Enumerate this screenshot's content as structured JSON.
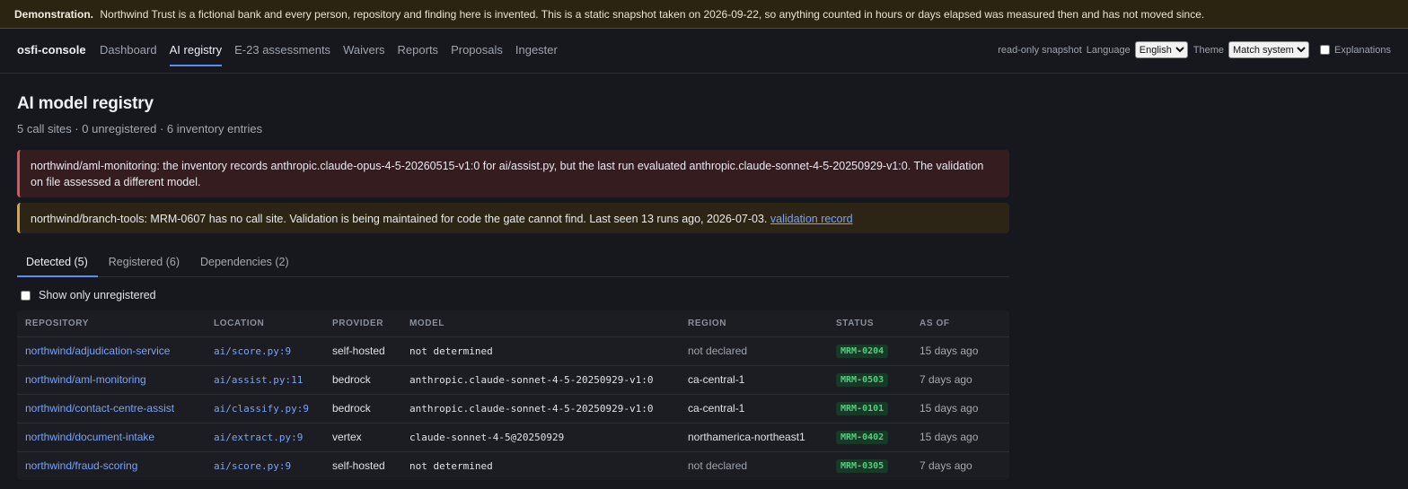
{
  "banner": {
    "label": "Demonstration.",
    "text": "Northwind Trust is a fictional bank and every person, repository and finding here is invented. This is a static snapshot taken on 2026-09-22, so anything counted in hours or days elapsed was measured then and has not moved since."
  },
  "nav": {
    "brand": "osfi-console",
    "links": [
      "Dashboard",
      "AI registry",
      "E-23 assessments",
      "Waivers",
      "Reports",
      "Proposals",
      "Ingester"
    ],
    "active_index": 1,
    "snapshot_label": "read-only snapshot",
    "language_label": "Language",
    "language_value": "English",
    "theme_label": "Theme",
    "theme_value": "Match system",
    "explanations_label": "Explanations"
  },
  "page": {
    "title": "AI model registry",
    "summary": "5 call sites · 0 unregistered · 6 inventory entries"
  },
  "alerts": {
    "danger_text": "northwind/aml-monitoring: the inventory records anthropic.claude-opus-4-5-20260515-v1:0 for ai/assist.py, but the last run evaluated anthropic.claude-sonnet-4-5-20250929-v1:0. The validation on file assessed a different model.",
    "warn_text": "northwind/branch-tools: MRM-0607 has no call site. Validation is being maintained for code the gate cannot find. Last seen 13 runs ago, 2026-07-03.",
    "warn_link": "validation record"
  },
  "tabs": [
    "Detected (5)",
    "Registered (6)",
    "Dependencies (2)"
  ],
  "filter": {
    "label": "Show only unregistered"
  },
  "table": {
    "headers": [
      "REPOSITORY",
      "LOCATION",
      "PROVIDER",
      "MODEL",
      "REGION",
      "STATUS",
      "AS OF"
    ],
    "rows": [
      {
        "repo": "northwind/adjudication-service",
        "loc": "ai/score.py:9",
        "provider": "self-hosted",
        "model": "not determined",
        "region": "not declared",
        "status": "MRM-0204",
        "asof": "15 days ago"
      },
      {
        "repo": "northwind/aml-monitoring",
        "loc": "ai/assist.py:11",
        "provider": "bedrock",
        "model": "anthropic.claude-sonnet-4-5-20250929-v1:0",
        "region": "ca-central-1",
        "status": "MRM-0503",
        "asof": "7 days ago"
      },
      {
        "repo": "northwind/contact-centre-assist",
        "loc": "ai/classify.py:9",
        "provider": "bedrock",
        "model": "anthropic.claude-sonnet-4-5-20250929-v1:0",
        "region": "ca-central-1",
        "status": "MRM-0101",
        "asof": "15 days ago"
      },
      {
        "repo": "northwind/document-intake",
        "loc": "ai/extract.py:9",
        "provider": "vertex",
        "model": "claude-sonnet-4-5@20250929",
        "region": "northamerica-northeast1",
        "status": "MRM-0402",
        "asof": "15 days ago"
      },
      {
        "repo": "northwind/fraud-scoring",
        "loc": "ai/score.py:9",
        "provider": "self-hosted",
        "model": "not determined",
        "region": "not declared",
        "status": "MRM-0305",
        "asof": "7 days ago"
      }
    ]
  }
}
